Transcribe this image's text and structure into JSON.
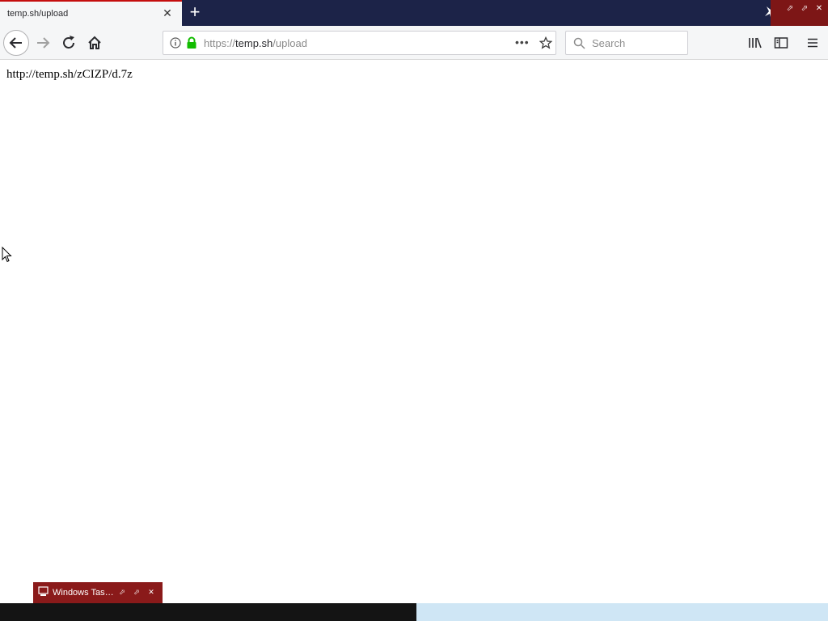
{
  "browser": {
    "tab_title": "temp.sh/upload",
    "url_prefix": "https://",
    "url_host": "temp.sh",
    "url_path": "/upload",
    "search_placeholder": "Search"
  },
  "page": {
    "link_text": "http://temp.sh/zCIZP/d.7z"
  },
  "taskbar": {
    "task_label": "Windows Tas…"
  },
  "colors": {
    "tabstrip_bg": "#1c2348",
    "tab_accent": "#c50e0e",
    "lock_green": "#12bc00",
    "taskbar_item": "#8a1a1a"
  }
}
